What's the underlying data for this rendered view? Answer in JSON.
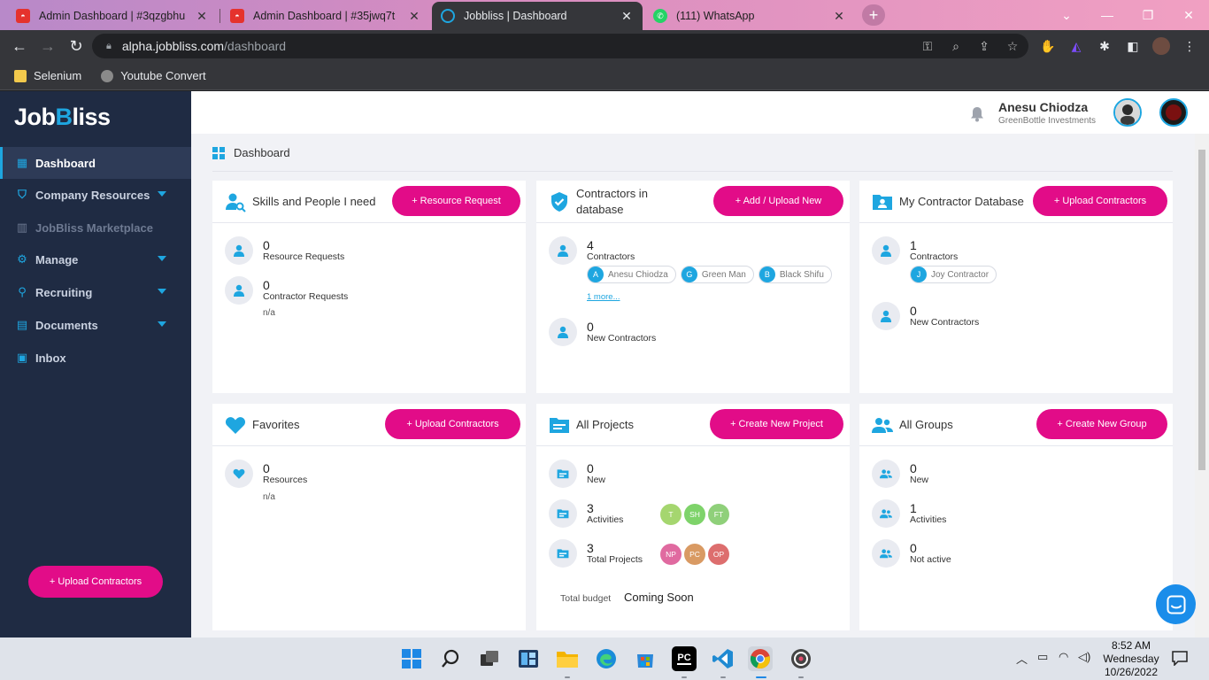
{
  "browser": {
    "tabs": [
      {
        "label": "Admin Dashboard | #3qzgbhu",
        "favicon": "admin-favicon",
        "close": "✕"
      },
      {
        "label": "Admin Dashboard | #35jwq7t",
        "favicon": "admin-favicon",
        "close": "✕"
      },
      {
        "label": "Jobbliss | Dashboard",
        "favicon": "jobbliss-favicon",
        "close": "✕"
      },
      {
        "label": "(111) WhatsApp",
        "favicon": "whatsapp-favicon",
        "close": "✕"
      }
    ],
    "url_host": "alpha.jobbliss.com",
    "url_path": "/dashboard",
    "bookmarks": [
      "Selenium",
      "Youtube Convert"
    ]
  },
  "sidebar": {
    "logo_a": "Job",
    "logo_b": "B",
    "logo_c": "liss",
    "items": [
      {
        "label": "Dashboard",
        "icon": "dashboard-icon"
      },
      {
        "label": "Company Resources",
        "icon": "shield-icon"
      },
      {
        "label": "JobBliss Marketplace",
        "icon": "marketplace-icon"
      },
      {
        "label": "Manage",
        "icon": "manage-icon"
      },
      {
        "label": "Recruiting",
        "icon": "recruiting-icon"
      },
      {
        "label": "Documents",
        "icon": "documents-icon"
      },
      {
        "label": "Inbox",
        "icon": "inbox-icon"
      }
    ],
    "upload_button": "+ Upload Contractors"
  },
  "header": {
    "user_name": "Anesu Chiodza",
    "company": "GreenBottle Investments"
  },
  "breadcrumb": "Dashboard",
  "cards": {
    "skills": {
      "title": "Skills and People I need",
      "button": "+ Resource Request",
      "rows": [
        {
          "num": "0",
          "label": "Resource Requests"
        },
        {
          "num": "0",
          "label": "Contractor Requests"
        }
      ],
      "note": "n/a"
    },
    "contractors": {
      "title": "Contractors in database",
      "button": "+ Add / Upload New",
      "rows": [
        {
          "num": "4",
          "label": "Contractors"
        },
        {
          "num": "0",
          "label": "New Contractors"
        }
      ],
      "chips": [
        {
          "initial": "A",
          "name": "Anesu Chiodza"
        },
        {
          "initial": "G",
          "name": "Green Man"
        },
        {
          "initial": "B",
          "name": "Black Shifu"
        }
      ],
      "more": "1 more..."
    },
    "mydb": {
      "title": "My Contractor Database",
      "button": "+ Upload Contractors",
      "rows": [
        {
          "num": "1",
          "label": "Contractors"
        },
        {
          "num": "0",
          "label": "New Contractors"
        }
      ],
      "chips": [
        {
          "initial": "J",
          "name": "Joy Contractor"
        }
      ]
    },
    "favorites": {
      "title": "Favorites",
      "button": "+ Upload Contractors",
      "rows": [
        {
          "num": "0",
          "label": "Resources"
        }
      ],
      "note": "n/a"
    },
    "projects": {
      "title": "All Projects",
      "button": "+ Create New Project",
      "rows": [
        {
          "num": "0",
          "label": "New"
        },
        {
          "num": "3",
          "label": "Activities"
        },
        {
          "num": "3",
          "label": "Total Projects"
        }
      ],
      "activity_pills": [
        "T",
        "SH",
        "FT"
      ],
      "project_pills": [
        "NP",
        "PC",
        "OP"
      ],
      "budget_label": "Total budget",
      "budget_value": "Coming Soon"
    },
    "groups": {
      "title": "All Groups",
      "button": "+ Create New Group",
      "rows": [
        {
          "num": "0",
          "label": "New"
        },
        {
          "num": "1",
          "label": "Activities"
        },
        {
          "num": "0",
          "label": "Not active"
        }
      ]
    }
  },
  "colors": {
    "accent": "#e20c88",
    "brand": "#1ea6e0",
    "sidebar": "#1f2b43"
  },
  "taskbar": {
    "time": "8:52 AM",
    "day": "Wednesday",
    "date": "10/26/2022",
    "apps": [
      "start-icon",
      "search-icon",
      "task-view-icon",
      "widgets-icon",
      "file-explorer-icon",
      "edge-icon",
      "store-icon",
      "pycharm-icon",
      "vscode-icon",
      "chrome-icon",
      "obs-icon"
    ],
    "pycharm_label": "PC"
  }
}
